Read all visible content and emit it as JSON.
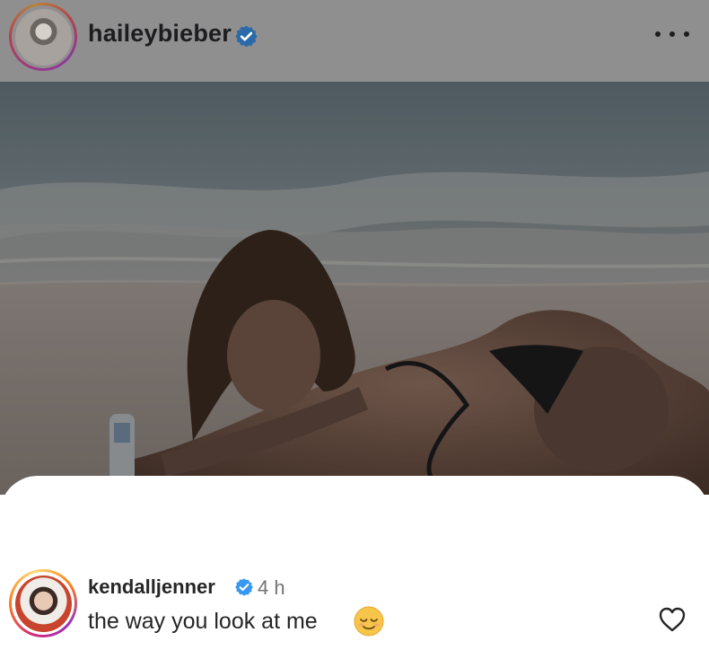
{
  "post": {
    "author": "haileybieber",
    "verified": true,
    "more_icon": "more-horizontal-icon"
  },
  "comment": {
    "author": "kendalljenner",
    "verified": true,
    "time": "4 h",
    "text": "the way you look at me",
    "emoji": "😌",
    "like_icon": "heart-outline-icon"
  },
  "colors": {
    "verified_blue": "#3897f0",
    "header_dim": "#8f8f90",
    "text_dark": "#262626",
    "text_muted": "#737373"
  }
}
